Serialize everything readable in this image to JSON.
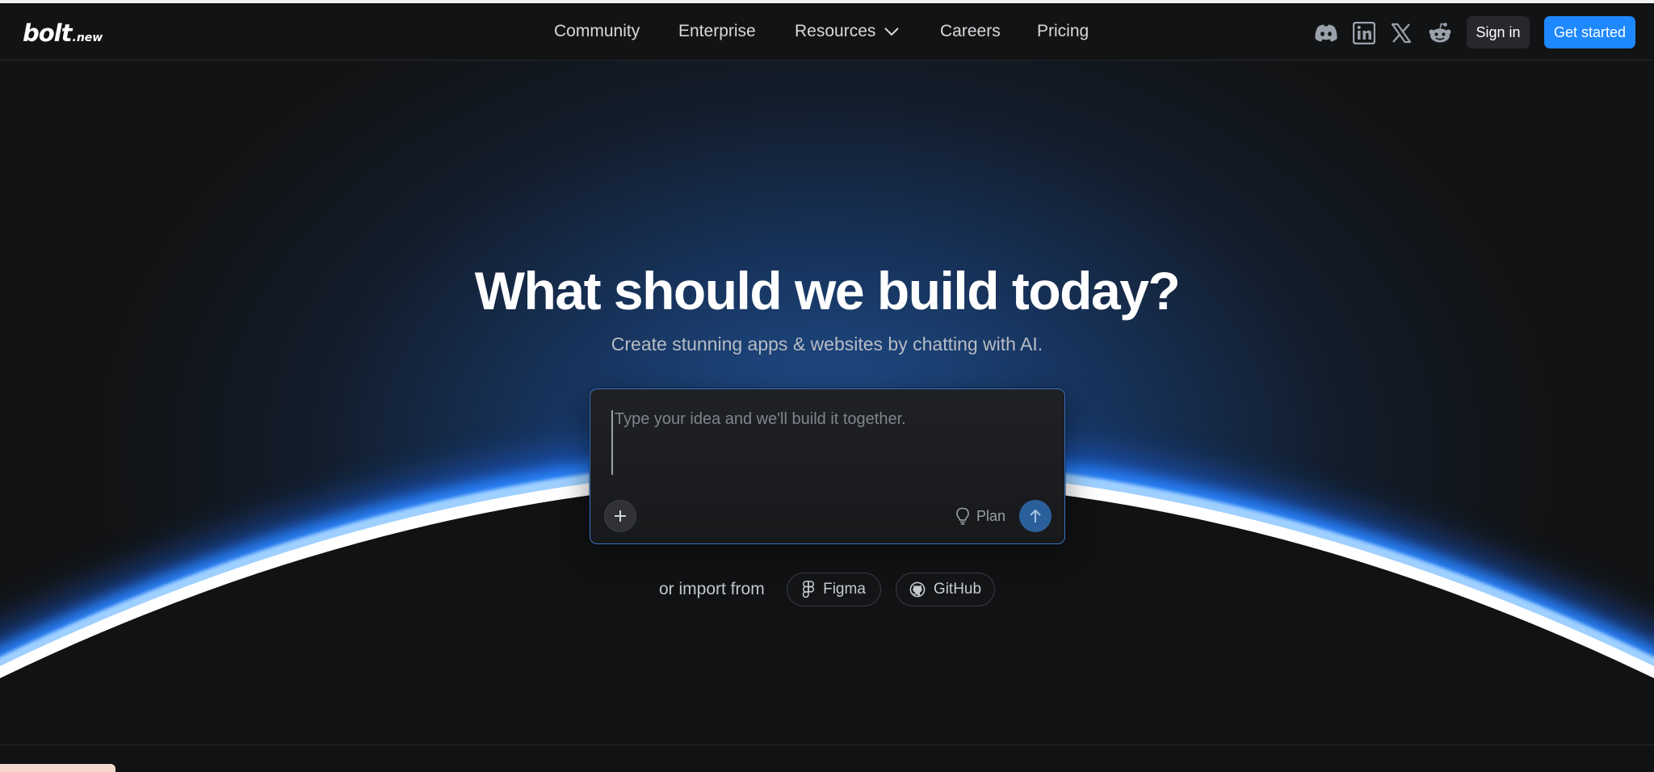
{
  "brand": {
    "logo_main": "bolt",
    "logo_sub": ".new",
    "accent_color": "#1e88ff"
  },
  "nav": {
    "links": [
      {
        "label": "Community"
      },
      {
        "label": "Enterprise"
      },
      {
        "label": "Resources"
      },
      {
        "label": "Careers"
      },
      {
        "label": "Pricing"
      }
    ],
    "social_icons": [
      "discord-icon",
      "linkedin-icon",
      "x-icon",
      "reddit-icon"
    ],
    "sign_in_label": "Sign in",
    "get_started_label": "Get started"
  },
  "hero": {
    "title": "What should we build today?",
    "subtitle": "Create stunning apps & websites by chatting with AI."
  },
  "prompt": {
    "placeholder": "Type your idea and we'll build it together.",
    "value": "",
    "plan_label": "Plan",
    "icons": {
      "attach": "plus-icon",
      "plan": "lightbulb-icon",
      "send": "arrow-up-icon"
    }
  },
  "import": {
    "label": "or import from",
    "sources": [
      {
        "label": "Figma",
        "icon": "figma-icon"
      },
      {
        "label": "GitHub",
        "icon": "github-icon"
      }
    ]
  }
}
